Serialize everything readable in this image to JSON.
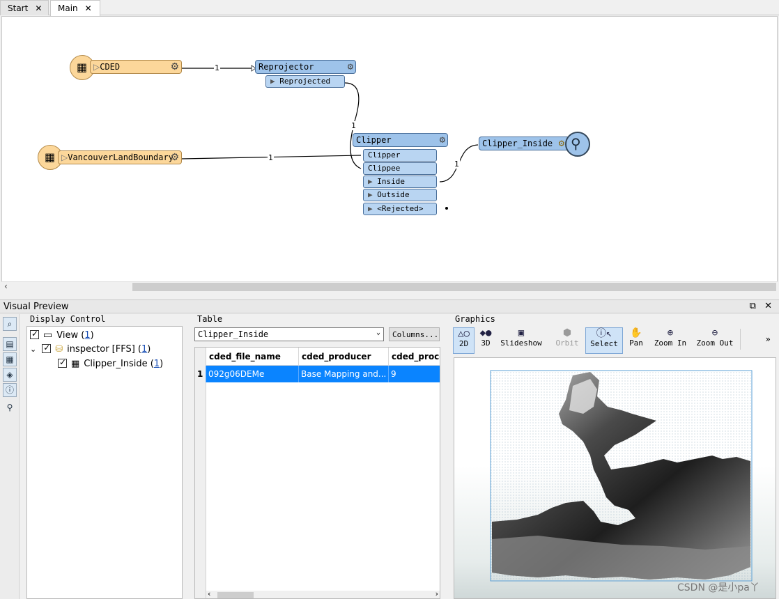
{
  "tabs": [
    {
      "label": "Start"
    },
    {
      "label": "Main"
    }
  ],
  "workspace": {
    "readers": {
      "cded": "CDED",
      "boundary": "VancouverLandBoundary"
    },
    "reprojector": {
      "title": "Reprojector",
      "port": "Reprojected"
    },
    "clipper": {
      "title": "Clipper",
      "inputs": [
        "Clipper",
        "Clippee"
      ],
      "outputs": [
        "Inside",
        "Outside",
        "<Rejected>"
      ]
    },
    "inspector": {
      "title": "Clipper_Inside"
    },
    "link_counts": {
      "cded_reprojector": "1",
      "reprojected_clipper": "1",
      "boundary_clipper": "1",
      "inside_inspector": "1"
    }
  },
  "visual_preview": {
    "title": "Visual Preview",
    "display_control": {
      "title": "Display Control",
      "view": {
        "label": "View (",
        "count": "1",
        "close": ")"
      },
      "inspector": {
        "label": "inspector [FFS] (",
        "count": "1",
        "close": ")"
      },
      "layer": {
        "label": "Clipper_Inside (",
        "count": "1",
        "close": ")"
      }
    },
    "table": {
      "title": "Table",
      "selected": "Clipper_Inside",
      "columns_button": "Columns...",
      "headers": [
        "cded_file_name",
        "cded_producer",
        "cded_proces"
      ],
      "rows": [
        {
          "num": "1",
          "cells": [
            "092g06DEMe",
            "Base Mapping and...",
            "9"
          ]
        }
      ]
    },
    "graphics": {
      "title": "Graphics",
      "tools": [
        {
          "label": "2D",
          "icon": "2d-shapes-icon"
        },
        {
          "label": "3D",
          "icon": "3d-shapes-icon"
        },
        {
          "label": "Slideshow",
          "icon": "slideshow-icon"
        },
        {
          "label": "Orbit",
          "icon": "orbit-icon"
        },
        {
          "label": "Select",
          "icon": "select-cursor-icon"
        },
        {
          "label": "Pan",
          "icon": "hand-icon"
        },
        {
          "label": "Zoom In",
          "icon": "zoom-in-icon"
        },
        {
          "label": "Zoom Out",
          "icon": "zoom-out-icon"
        }
      ]
    }
  },
  "watermark": "CSDN @是小pa丫",
  "colors": {
    "reader": "#fcd79a",
    "transformer": "#9ec3ea",
    "selection": "#0a84ff"
  }
}
